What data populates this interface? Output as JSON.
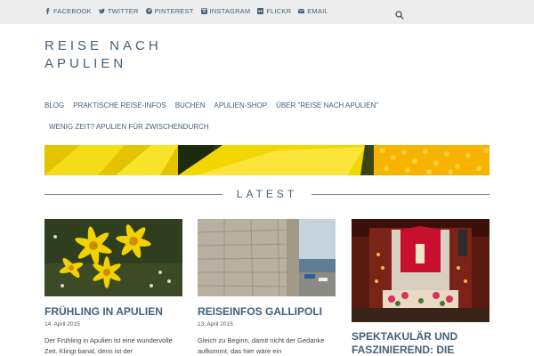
{
  "topbar": {
    "social": [
      {
        "label": "FACEBOOK",
        "icon": "facebook-icon"
      },
      {
        "label": "TWITTER",
        "icon": "twitter-icon"
      },
      {
        "label": "PINTEREST",
        "icon": "pinterest-icon"
      },
      {
        "label": "INSTAGRAM",
        "icon": "instagram-icon"
      },
      {
        "label": "FLICKR",
        "icon": "flickr-icon"
      },
      {
        "label": "EMAIL",
        "icon": "email-icon"
      }
    ],
    "search_icon": "search-icon"
  },
  "site": {
    "title": "REISE NACH APULIEN"
  },
  "nav": {
    "items": [
      "BLOG",
      "PRAKTISCHE REISE-INFOS",
      "BUCHEN",
      "APULIEN-SHOP",
      "ÜBER \"REISE NACH APULIEN\"",
      "WENIG ZEIT? APULIEN FÜR ZWISCHENDURCH"
    ]
  },
  "section": {
    "label": "LATEST"
  },
  "posts": [
    {
      "title": "FRÜHLING IN APULIEN",
      "date": "14. April 2015",
      "excerpt": "Der Frühling in Apulien ist eine wundervolle Zeit. Klingt banal, denn ist der"
    },
    {
      "title": "REISEINFOS GALLIPOLI",
      "date": "13. April 2015",
      "excerpt": "Gleich zu Beginn, damit nicht der Gedanke aufkommt, das hier wäre ein"
    },
    {
      "title": "SPEKTAKULÄR UND FASZINIEREND: DIE",
      "date": "",
      "excerpt": ""
    }
  ],
  "colors": {
    "accent": "#44607a",
    "topbar_bg": "#ededed"
  }
}
